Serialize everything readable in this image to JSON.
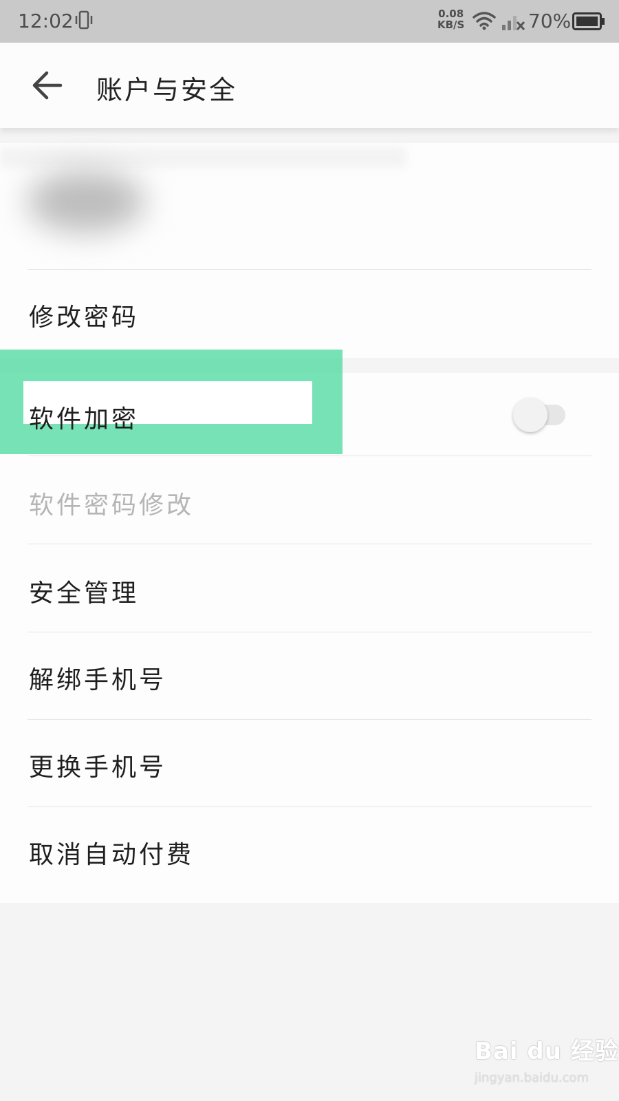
{
  "status_bar": {
    "time": "12:02",
    "net_speed_value": "0.08",
    "net_speed_unit": "KB/S",
    "battery": "70%"
  },
  "app_bar": {
    "title": "账户与安全"
  },
  "settings": {
    "change_password": "修改密码",
    "app_lock": {
      "label": "软件加密",
      "enabled": false
    },
    "app_lock_password_change": {
      "label": "软件密码修改",
      "disabled": true
    },
    "security_management": "安全管理",
    "unbind_phone": "解绑手机号",
    "change_phone": "更换手机号",
    "cancel_auto_pay": "取消自动付费"
  },
  "watermark": {
    "main": "Bai du 经验",
    "sub": "jingyan.baidu.com"
  },
  "colors": {
    "highlight": "#4fdaa2",
    "status_bar_bg": "#c9c9c9",
    "disabled_text": "#b5b5b5"
  }
}
